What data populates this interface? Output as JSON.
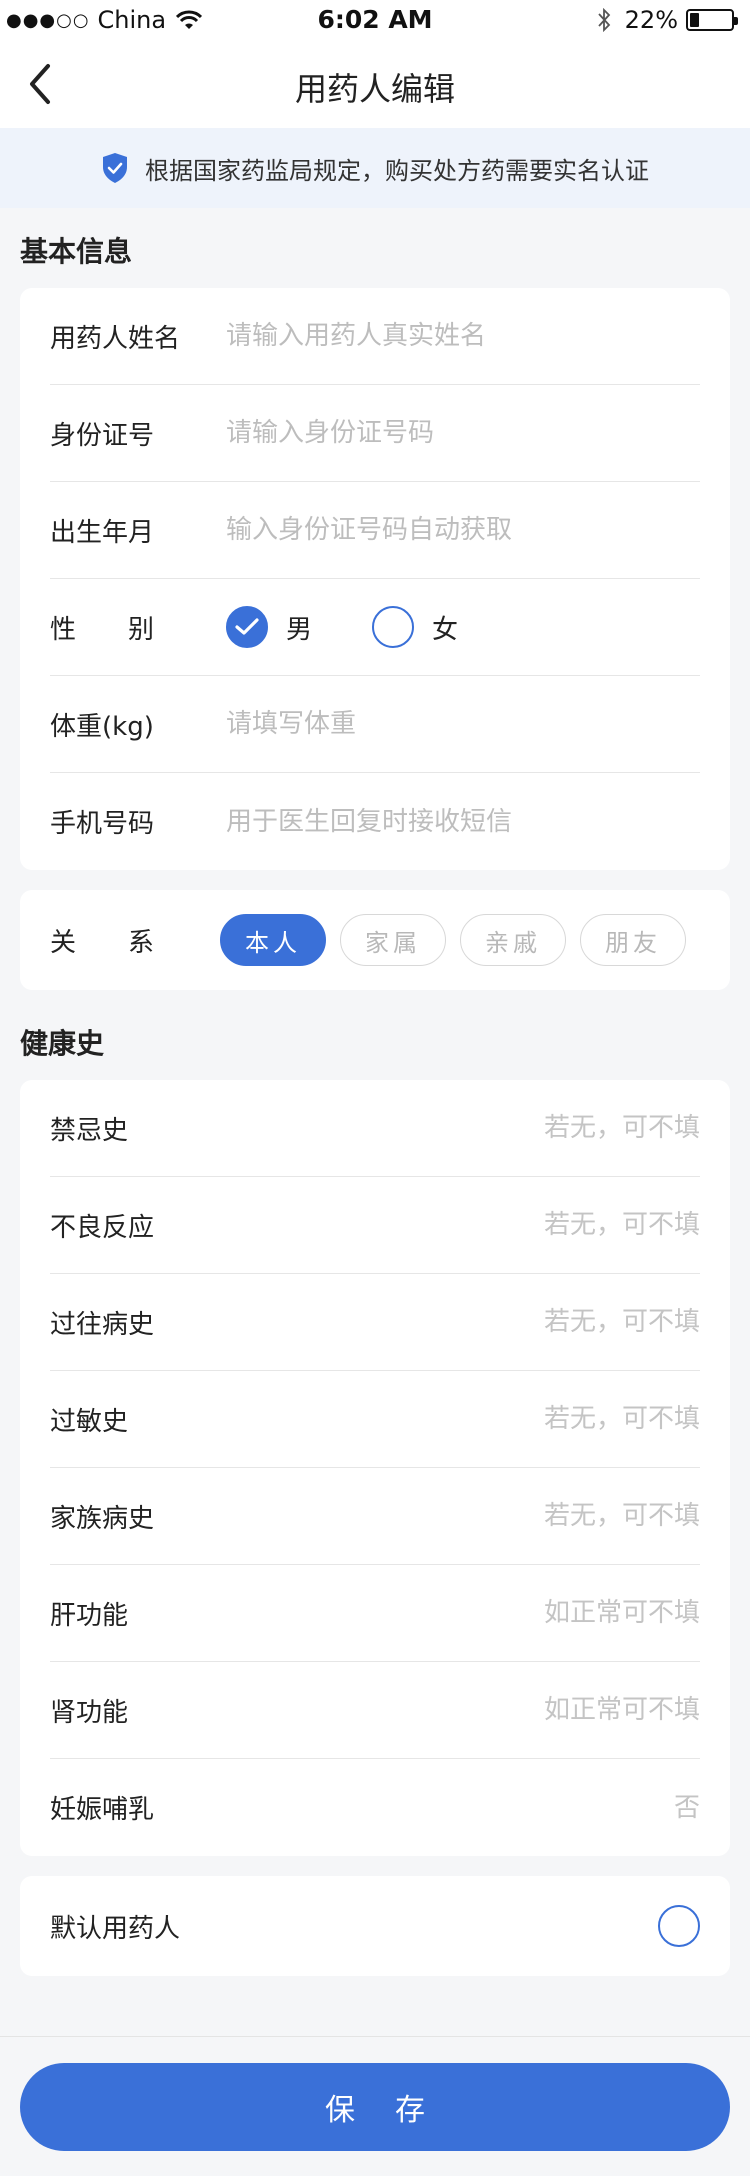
{
  "status_bar": {
    "signal": "●●●○○",
    "carrier": "China",
    "time": "6:02 AM",
    "battery_percent": "22%",
    "battery_level": 0.22
  },
  "nav": {
    "title": "用药人编辑"
  },
  "notice": {
    "text": "根据国家药监局规定，购买处方药需要实名认证"
  },
  "basic_info": {
    "title": "基本信息",
    "name_label": "用药人姓名",
    "name_placeholder": "请输入用药人真实姓名",
    "id_label": "身份证号",
    "id_placeholder": "请输入身份证号码",
    "birth_label": "出生年月",
    "birth_placeholder": "输入身份证号码自动获取",
    "gender_label": "性　　别",
    "gender_male": "男",
    "gender_female": "女",
    "weight_label": "体重(kg)",
    "weight_placeholder": "请填写体重",
    "phone_label": "手机号码",
    "phone_placeholder": "用于医生回复时接收短信"
  },
  "relation": {
    "label": "关　　系",
    "options": [
      "本人",
      "家属",
      "亲戚",
      "朋友"
    ]
  },
  "health": {
    "title": "健康史",
    "items": [
      {
        "label": "禁忌史",
        "placeholder": "若无，可不填"
      },
      {
        "label": "不良反应",
        "placeholder": "若无，可不填"
      },
      {
        "label": "过往病史",
        "placeholder": "若无，可不填"
      },
      {
        "label": "过敏史",
        "placeholder": "若无，可不填"
      },
      {
        "label": "家族病史",
        "placeholder": "若无，可不填"
      },
      {
        "label": "肝功能",
        "placeholder": "如正常可不填"
      },
      {
        "label": "肾功能",
        "placeholder": "如正常可不填"
      },
      {
        "label": "妊娠哺乳",
        "placeholder": "否"
      }
    ]
  },
  "default_user": {
    "label": "默认用药人"
  },
  "save_button": {
    "label": "保存"
  },
  "colors": {
    "accent": "#3a70d8",
    "background": "#f5f6f8",
    "placeholder": "#bdbdbd"
  }
}
